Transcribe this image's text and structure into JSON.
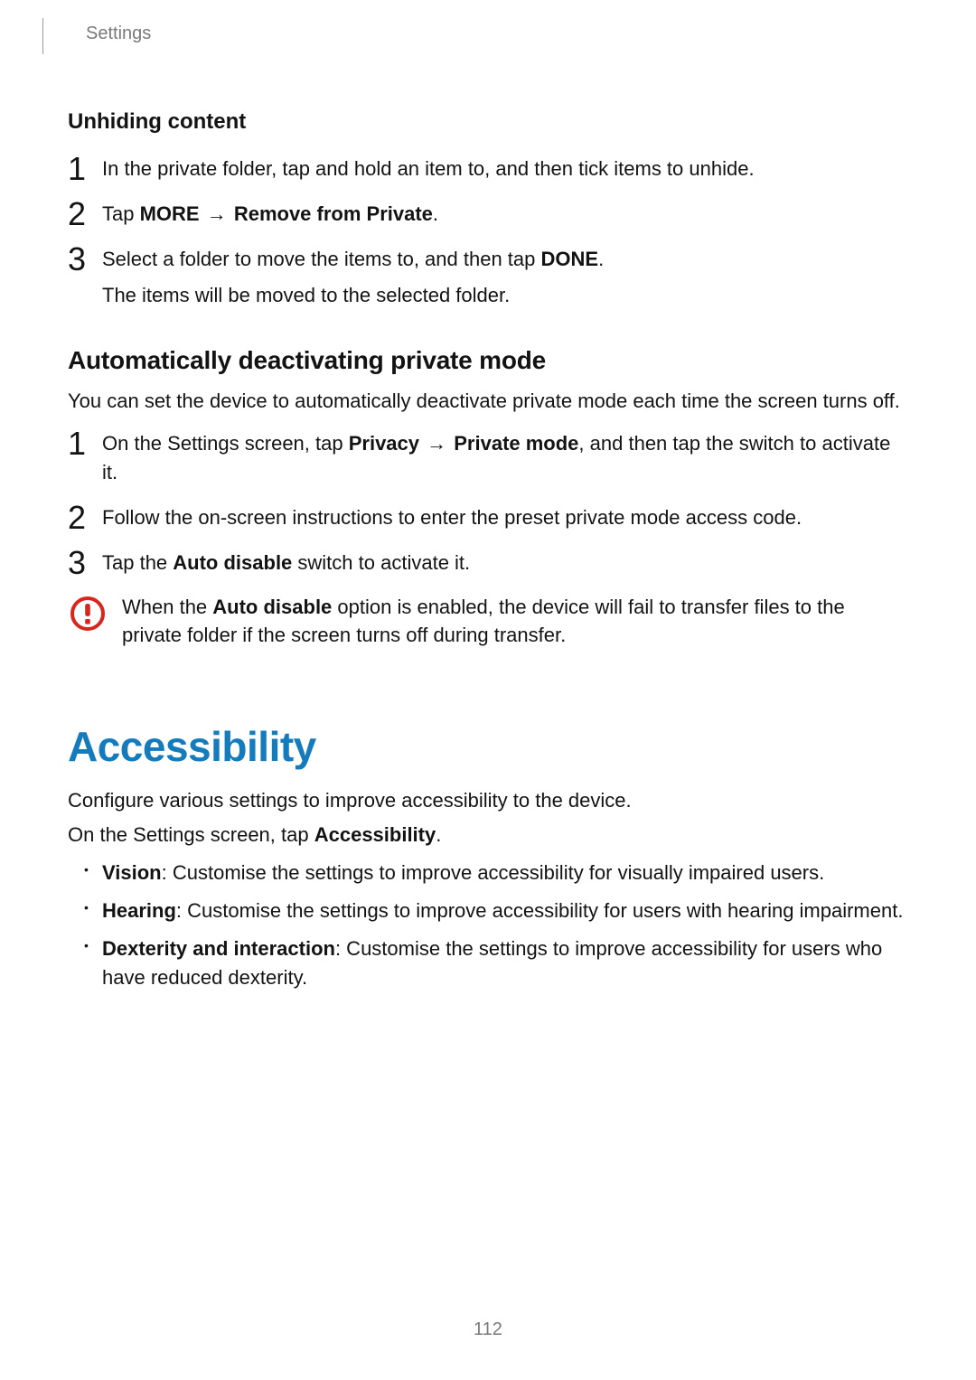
{
  "header": {
    "label": "Settings"
  },
  "sectionA": {
    "title": "Unhiding content",
    "steps": [
      {
        "num": "1",
        "segments": [
          {
            "t": "In the private folder, tap and hold an item to, and then tick items to unhide."
          }
        ]
      },
      {
        "num": "2",
        "segments": [
          {
            "t": "Tap "
          },
          {
            "t": "MORE",
            "b": true
          },
          {
            "t": " → ",
            "arrow": true
          },
          {
            "t": "Remove from Private",
            "b": true
          },
          {
            "t": "."
          }
        ]
      },
      {
        "num": "3",
        "segments": [
          {
            "t": "Select a folder to move the items to, and then tap "
          },
          {
            "t": "DONE",
            "b": true
          },
          {
            "t": "."
          }
        ],
        "sub": "The items will be moved to the selected folder."
      }
    ]
  },
  "sectionB": {
    "title": "Automatically deactivating private mode",
    "intro": "You can set the device to automatically deactivate private mode each time the screen turns off.",
    "steps": [
      {
        "num": "1",
        "segments": [
          {
            "t": "On the Settings screen, tap "
          },
          {
            "t": "Privacy",
            "b": true
          },
          {
            "t": " → ",
            "arrow": true
          },
          {
            "t": "Private mode",
            "b": true
          },
          {
            "t": ", and then tap the switch to activate it."
          }
        ]
      },
      {
        "num": "2",
        "segments": [
          {
            "t": "Follow the on-screen instructions to enter the preset private mode access code."
          }
        ]
      },
      {
        "num": "3",
        "segments": [
          {
            "t": "Tap the "
          },
          {
            "t": "Auto disable",
            "b": true
          },
          {
            "t": " switch to activate it."
          }
        ]
      }
    ],
    "callout": {
      "icon_name": "warning-icon",
      "segments": [
        {
          "t": "When the "
        },
        {
          "t": "Auto disable",
          "b": true
        },
        {
          "t": " option is enabled, the device will fail to transfer files to the private folder if the screen turns off during transfer."
        }
      ]
    }
  },
  "sectionC": {
    "title": "Accessibility",
    "intro1": "Configure various settings to improve accessibility to the device.",
    "intro2_segments": [
      {
        "t": "On the Settings screen, tap "
      },
      {
        "t": "Accessibility",
        "b": true
      },
      {
        "t": "."
      }
    ],
    "bullets": [
      {
        "segments": [
          {
            "t": "Vision",
            "b": true
          },
          {
            "t": ": Customise the settings to improve accessibility for visually impaired users."
          }
        ]
      },
      {
        "segments": [
          {
            "t": "Hearing",
            "b": true
          },
          {
            "t": ": Customise the settings to improve accessibility for users with hearing impairment."
          }
        ]
      },
      {
        "segments": [
          {
            "t": "Dexterity and interaction",
            "b": true
          },
          {
            "t": ": Customise the settings to improve accessibility for users who have reduced dexterity."
          }
        ]
      }
    ]
  },
  "page_number": "112",
  "colors": {
    "accent": "#147bbd",
    "warning": "#d9261c"
  }
}
